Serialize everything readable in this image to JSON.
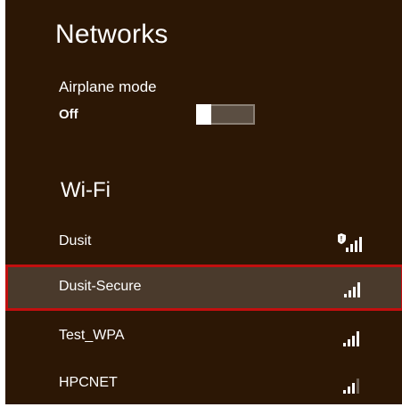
{
  "title": "Networks",
  "airplane": {
    "label": "Airplane mode",
    "state": "Off"
  },
  "wifi": {
    "section_title": "Wi-Fi",
    "networks": [
      {
        "name": "Dusit",
        "signal_bars": 4,
        "secured_badge": true,
        "selected": false
      },
      {
        "name": "Dusit-Secure",
        "signal_bars": 4,
        "secured_badge": false,
        "selected": true
      },
      {
        "name": "Test_WPA",
        "signal_bars": 4,
        "secured_badge": false,
        "selected": false
      },
      {
        "name": "HPCNET",
        "signal_bars": 3,
        "secured_badge": false,
        "selected": false
      }
    ]
  },
  "colors": {
    "panel_bg": "#2c1705",
    "selected_bg": "#4a3a2c",
    "selected_border": "#c20f0f",
    "text": "#ffffff",
    "bar_dim": "#6b5d50"
  }
}
